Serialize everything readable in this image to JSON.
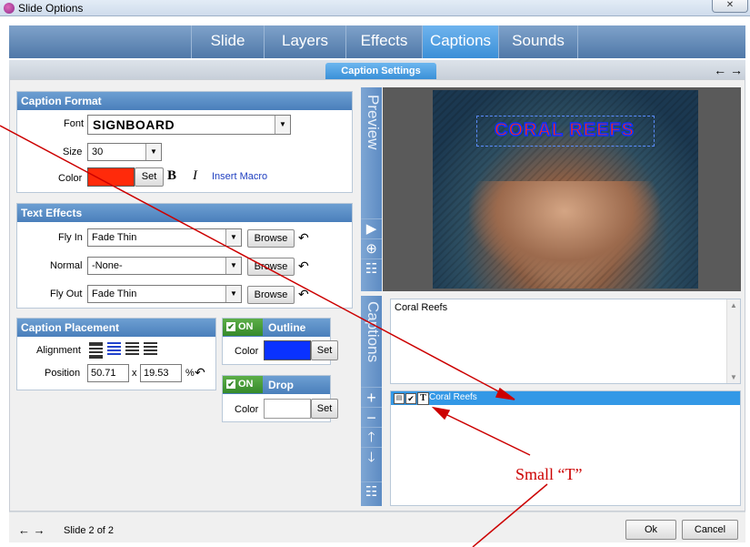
{
  "window": {
    "title": "Slide Options",
    "close_glyph": "✕"
  },
  "tabs": [
    "Slide",
    "Layers",
    "Effects",
    "Captions",
    "Sounds"
  ],
  "active_tab": "Captions",
  "subtab": "Caption Settings",
  "nav_arrows": "← →",
  "caption_format": {
    "header": "Caption Format",
    "font_label": "Font",
    "font_value": "SIGNBOARD",
    "size_label": "Size",
    "size_value": "30",
    "color_label": "Color",
    "color_hex": "#ff2a0a",
    "set_label": "Set",
    "bold_label": "B",
    "italic_label": "I",
    "insert_macro": "Insert Macro"
  },
  "text_effects": {
    "header": "Text Effects",
    "rows": [
      {
        "label": "Fly In",
        "value": "Fade Thin",
        "browse": "Browse"
      },
      {
        "label": "Normal",
        "value": "-None-",
        "browse": "Browse"
      },
      {
        "label": "Fly Out",
        "value": "Fade Thin",
        "browse": "Browse"
      }
    ]
  },
  "caption_placement": {
    "header": "Caption Placement",
    "alignment_label": "Alignment",
    "position_label": "Position",
    "pos_x": "50.71",
    "x_sep": "x",
    "pos_y": "19.53",
    "pct": "%"
  },
  "outline": {
    "on": "ON",
    "header": "Outline",
    "color_label": "Color",
    "color_hex": "#0a32ff",
    "set_label": "Set"
  },
  "drop_shadow": {
    "on": "ON",
    "header": "Drop Shadow",
    "color_label": "Color",
    "color_hex": "#ffffff",
    "set_label": "Set"
  },
  "preview": {
    "side_label": "Preview",
    "caption_text": "CORAL REEFS"
  },
  "captions": {
    "side_label": "Captions",
    "text_value": "Coral Reefs",
    "list_items": [
      {
        "label": "Coral Reefs",
        "type_glyph": "T"
      }
    ]
  },
  "annotation": {
    "text": "Small “T”",
    "color": "#cc0000"
  },
  "footer": {
    "slide_text": "Slide 2 of 2",
    "ok": "Ok",
    "cancel": "Cancel"
  }
}
